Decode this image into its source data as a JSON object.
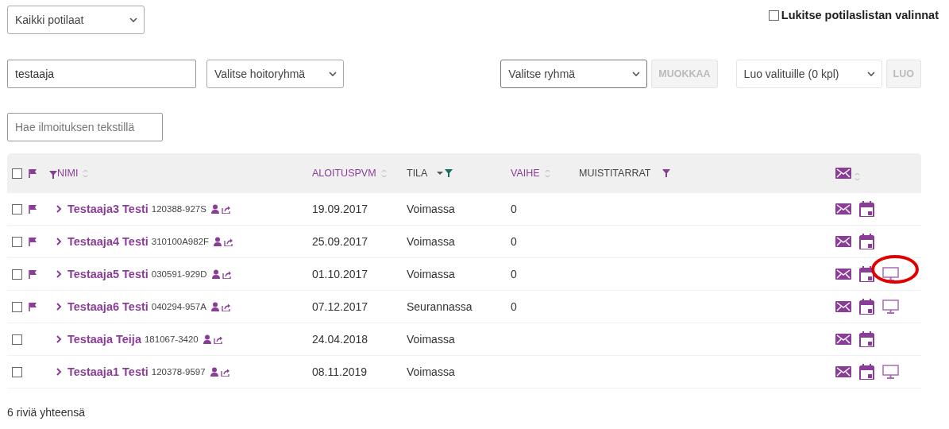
{
  "patient_filter": {
    "value": "Kaikki potilaat"
  },
  "lock_option": {
    "label": "Lukitse potilaslistan valinnat",
    "checked": false
  },
  "search_name": {
    "value": "testaaja"
  },
  "care_group": {
    "value": "Valitse hoitoryhmä"
  },
  "group_select": {
    "value": "Valitse ryhmä"
  },
  "edit_button": {
    "label": "MUOKKAA",
    "disabled": true
  },
  "create_select": {
    "value": "Luo valituille (0 kpl)"
  },
  "create_button": {
    "label": "LUO",
    "disabled": true
  },
  "notice_search": {
    "placeholder": "Hae ilmoituksen tekstillä"
  },
  "table": {
    "select_all": false,
    "columns": [
      {
        "label": "NIMI",
        "sortable": true,
        "filter_leading": true,
        "filter_active": false,
        "filter_trailing": false
      },
      {
        "label": "ALOITUSPVM",
        "sortable": true,
        "filter_leading": false,
        "filter_active": false,
        "filter_trailing": false
      },
      {
        "label": "TILA",
        "sortable": false,
        "filter_leading": false,
        "filter_active": true,
        "filter_trailing": false
      },
      {
        "label": "VAIHE",
        "sortable": true,
        "filter_leading": false,
        "filter_active": false,
        "filter_trailing": false
      },
      {
        "label": "MUISTITARRAT",
        "sortable": false,
        "filter_leading": false,
        "filter_active": false,
        "filter_trailing": true
      }
    ],
    "rows": [
      {
        "checked": false,
        "flagged": true,
        "name": "Testaaja3 Testi",
        "id": "120388-927S",
        "start_date": "19.09.2017",
        "status": "Voimassa",
        "phase": "0",
        "monitor": false,
        "highlighted": false
      },
      {
        "checked": false,
        "flagged": true,
        "name": "Testaaja4 Testi",
        "id": "310100A982F",
        "start_date": "25.09.2017",
        "status": "Voimassa",
        "phase": "0",
        "monitor": false,
        "highlighted": false
      },
      {
        "checked": false,
        "flagged": true,
        "name": "Testaaja5 Testi",
        "id": "030591-929D",
        "start_date": "01.10.2017",
        "status": "Voimassa",
        "phase": "0",
        "monitor": true,
        "highlighted": true
      },
      {
        "checked": false,
        "flagged": true,
        "name": "Testaaja6 Testi",
        "id": "040294-957A",
        "start_date": "07.12.2017",
        "status": "Seurannassa",
        "phase": "0",
        "monitor": true,
        "highlighted": false
      },
      {
        "checked": false,
        "flagged": false,
        "name": "Testaaja Teija",
        "id": "181067-3420",
        "start_date": "24.04.2018",
        "status": "Voimassa",
        "monitor": false,
        "highlighted": false
      },
      {
        "checked": false,
        "flagged": false,
        "name": "Testaaja1 Testi",
        "id": "120378-9597",
        "start_date": "08.11.2019",
        "status": "Voimassa",
        "monitor": true,
        "highlighted": false
      }
    ]
  },
  "footer": {
    "text": "6 riviä yhteensä"
  }
}
